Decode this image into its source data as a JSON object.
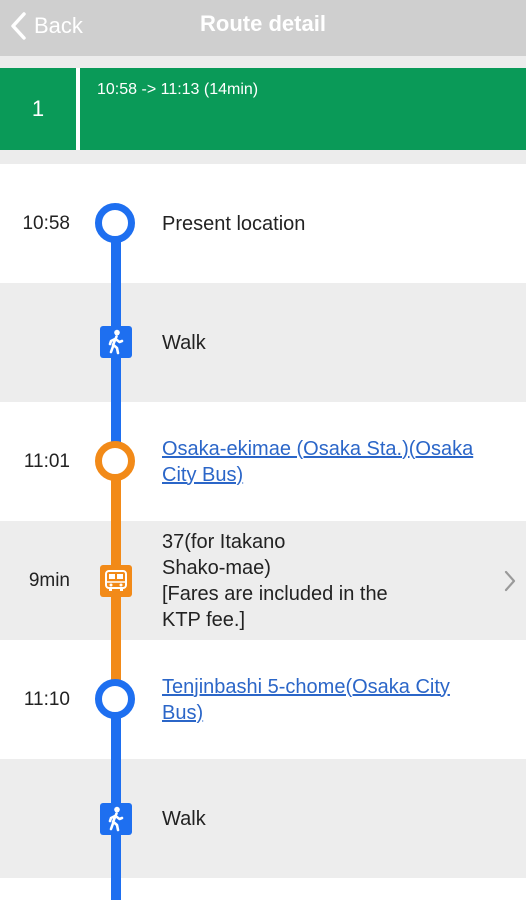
{
  "nav": {
    "back_label": "Back",
    "title": "Route detail"
  },
  "route": {
    "number": "1",
    "time_range": "10:58 -> 11:13 (14min)"
  },
  "steps": [
    {
      "time": "10:58",
      "label": "Present location"
    },
    {
      "label": "Walk",
      "icon": "walk-icon"
    },
    {
      "time": "11:01",
      "label": "Osaka-ekimae (Osaka Sta.)(Osaka City Bus)"
    },
    {
      "time": "9min",
      "label_lines": [
        "37(for Itakano",
        "Shako-mae)",
        "[Fares are included in the",
        "KTP fee.]"
      ],
      "icon": "bus-icon"
    },
    {
      "time": "11:10",
      "label": "Tenjinbashi 5-chome(Osaka City Bus)"
    },
    {
      "label": "Walk",
      "icon": "walk-icon"
    }
  ],
  "colors": {
    "header_green": "#0a9a58",
    "walk_blue": "#1e6ff0",
    "bus_orange": "#f28a18",
    "link": "#2b66c8"
  }
}
